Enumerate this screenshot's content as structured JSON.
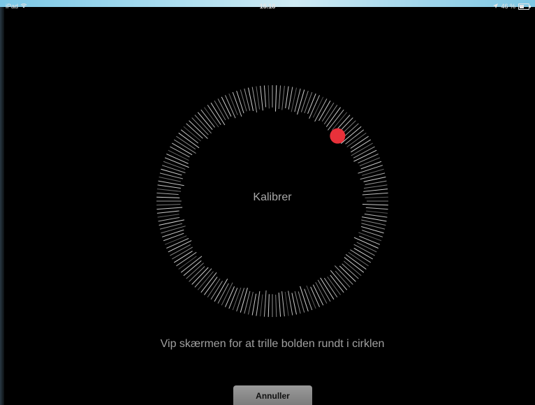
{
  "status_bar": {
    "device": "iPad",
    "time": "15.18",
    "battery_text": "46 %",
    "battery_level": 0.46
  },
  "calibration": {
    "center_label": "Kalibrer",
    "ball_color": "#e8313a",
    "ball_angle_deg": 315
  },
  "instruction": "Vip skærmen for at trille bolden rundt i cirklen",
  "cancel_label": "Annuller"
}
